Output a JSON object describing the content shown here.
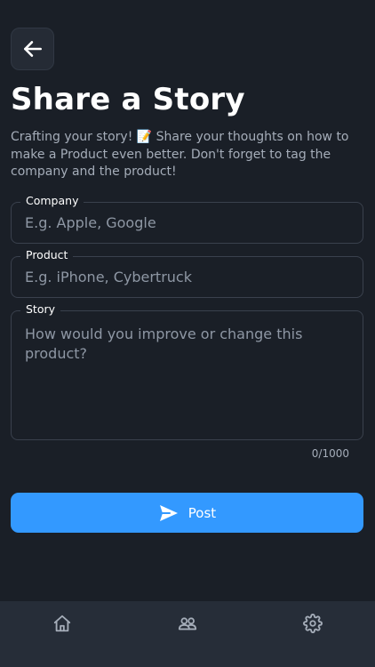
{
  "header": {
    "title": "Share a Story",
    "subtitle": "Crafting your story! 📝 Share your thoughts on how to make a Product even better. Don't forget to tag the company and the product!"
  },
  "form": {
    "company": {
      "label": "Company",
      "placeholder": "E.g. Apple, Google",
      "value": ""
    },
    "product": {
      "label": "Product",
      "placeholder": "E.g. iPhone, Cybertruck",
      "value": ""
    },
    "story": {
      "label": "Story",
      "placeholder": "How would you improve or change this product?",
      "value": ""
    },
    "counter": "0/1000"
  },
  "actions": {
    "post_label": "Post"
  },
  "icons": {
    "back": "arrow-left-icon",
    "send": "send-icon",
    "nav": [
      "home-icon",
      "users-icon",
      "gear-icon"
    ]
  },
  "colors": {
    "background": "#1a1f27",
    "accent": "#3399ff",
    "nav_bar": "#262d38",
    "muted_text": "#a5adb9"
  }
}
